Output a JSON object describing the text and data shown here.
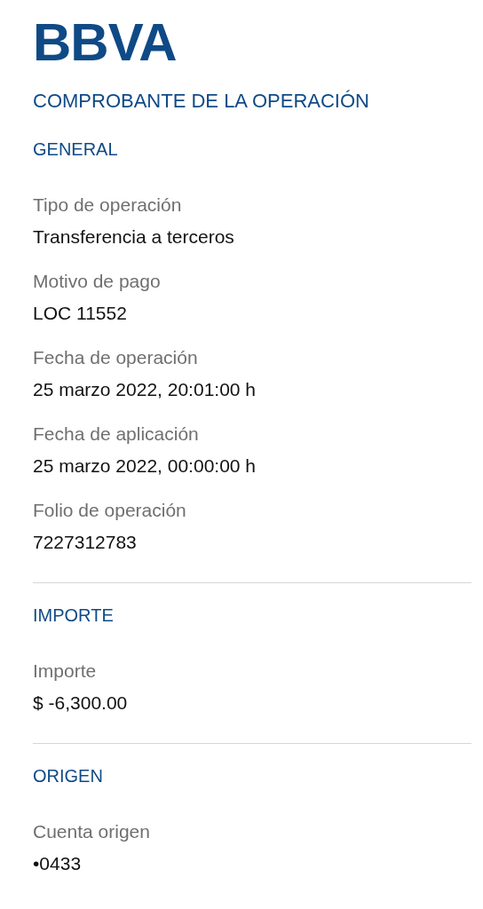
{
  "logo": "BBVA",
  "title": "COMPROBANTE DE LA OPERACIÓN",
  "sections": [
    {
      "heading": "GENERAL",
      "fields": [
        {
          "label": "Tipo de operación",
          "value": "Transferencia a terceros"
        },
        {
          "label": "Motivo de pago",
          "value": "LOC 11552"
        },
        {
          "label": "Fecha de operación",
          "value": "25 marzo 2022, 20:01:00 h"
        },
        {
          "label": "Fecha de aplicación",
          "value": "25 marzo 2022, 00:00:00 h"
        },
        {
          "label": "Folio de operación",
          "value": "7227312783"
        }
      ]
    },
    {
      "heading": "IMPORTE",
      "fields": [
        {
          "label": "Importe",
          "value": "$ -6,300.00"
        }
      ]
    },
    {
      "heading": "ORIGEN",
      "fields": [
        {
          "label": "Cuenta origen",
          "value": "•0433"
        }
      ]
    }
  ]
}
